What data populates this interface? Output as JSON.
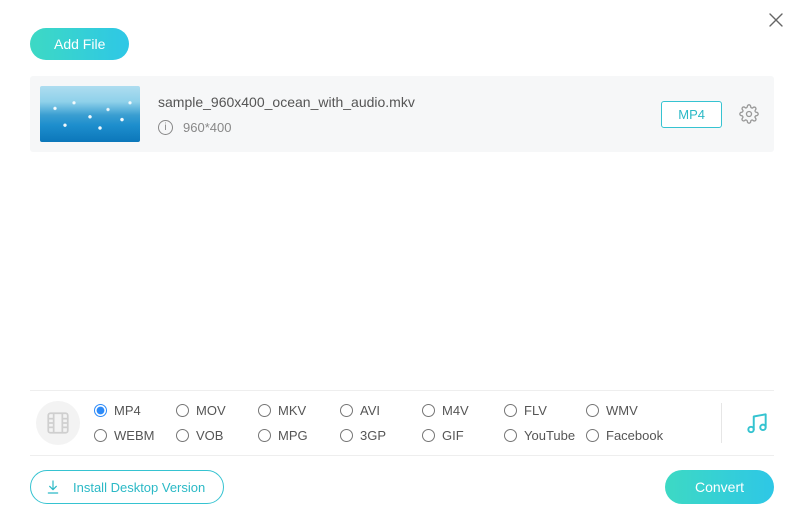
{
  "header": {
    "add_file_label": "Add File"
  },
  "file": {
    "name": "sample_960x400_ocean_with_audio.mkv",
    "dimensions": "960*400",
    "output_format_badge": "MP4"
  },
  "formats": {
    "selected": "MP4",
    "options": [
      "MP4",
      "MOV",
      "MKV",
      "AVI",
      "M4V",
      "FLV",
      "WMV",
      "WEBM",
      "VOB",
      "MPG",
      "3GP",
      "GIF",
      "YouTube",
      "Facebook"
    ]
  },
  "footer": {
    "install_label": "Install Desktop Version",
    "convert_label": "Convert"
  },
  "colors": {
    "accent": "#2bb9c6",
    "gradient_start": "#3dd9c4",
    "gradient_end": "#2ec7e6"
  }
}
